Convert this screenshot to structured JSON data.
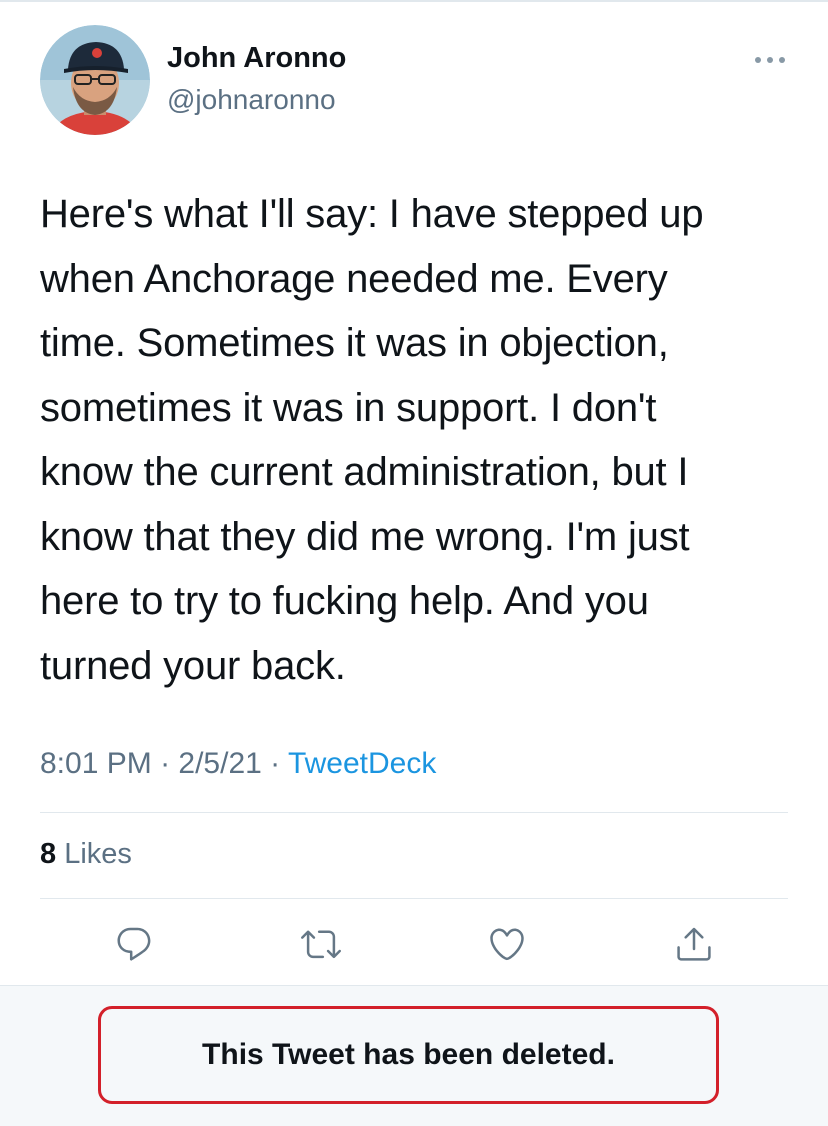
{
  "author": {
    "name": "John Aronno",
    "handle": "@johnaronno",
    "avatar_icon": "profile-photo"
  },
  "tweet": {
    "lines": [
      "Here's what I'll say: I have stepped up",
      "when Anchorage needed me. Every",
      "time. Sometimes it was in objection,",
      "sometimes it was in support. I don't",
      "know the current administration, but I",
      "know that they did me wrong. I'm just",
      "here to try to fucking help. And you",
      "turned your back."
    ]
  },
  "meta": {
    "time": "8:01 PM",
    "separator": " · ",
    "date": "2/5/21",
    "source": "TweetDeck"
  },
  "stats": {
    "likes_count": "8",
    "likes_label": " Likes"
  },
  "actions": {
    "reply_icon": "reply-icon",
    "retweet_icon": "retweet-icon",
    "like_icon": "heart-icon",
    "share_icon": "share-icon"
  },
  "notice": {
    "text": "This Tweet has been deleted.",
    "border_color": "#d3202a"
  },
  "colors": {
    "text_primary": "#0f1419",
    "text_secondary": "#5b7083",
    "link": "#1b95e0",
    "icon": "#657786"
  }
}
